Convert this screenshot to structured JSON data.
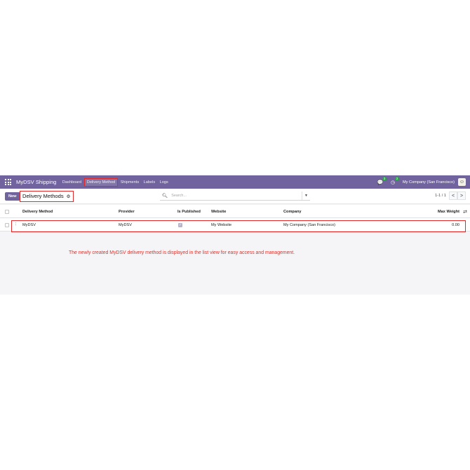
{
  "navbar": {
    "app_name": "MyDSV Shipping",
    "menu": [
      "Dashboard",
      "Delivery Method",
      "Shipments",
      "Labels",
      "Logs"
    ],
    "active_menu": "Delivery Method",
    "messages_badge": "3",
    "activities_badge": "2",
    "company": "My Company (San Francisco)",
    "colors": {
      "navbar_bg": "#71639e",
      "highlight": "#e02a2a"
    }
  },
  "control_panel": {
    "new_label": "New",
    "breadcrumb": "Delivery Methods",
    "search_placeholder": "Search...",
    "pager_value": "1-1 / 1",
    "pager_prev": "<",
    "pager_next": ">"
  },
  "table": {
    "columns": [
      "Delivery Method",
      "Provider",
      "Is Published",
      "Website",
      "Company",
      "Max Weight"
    ],
    "rows": [
      {
        "delivery_method": "MyDSV",
        "provider": "MyDSV",
        "is_published": true,
        "website": "My Website",
        "company": "My Company (San Francisco)",
        "max_weight": "0.00"
      }
    ]
  },
  "caption": "The newly created MyDSV delivery method is displayed in the list view for easy access and management."
}
